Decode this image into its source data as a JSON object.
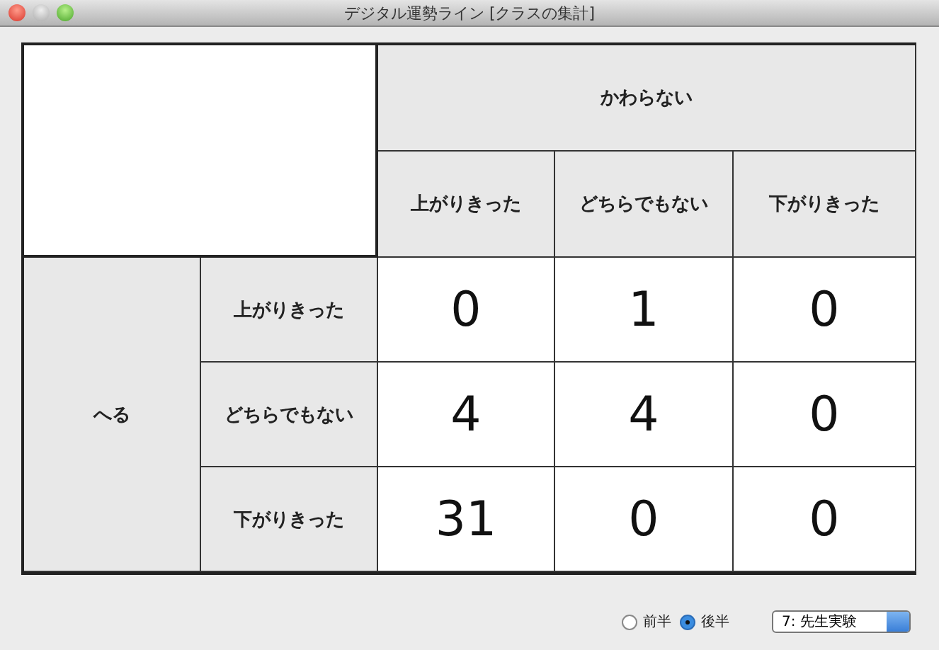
{
  "window": {
    "title": "デジタル運勢ライン [クラスの集計]"
  },
  "table": {
    "column_group": "かわらない",
    "columns": [
      "上がりきった",
      "どちらでもない",
      "下がりきった"
    ],
    "row_group": "へる",
    "rows": [
      {
        "label": "上がりきった",
        "cells": [
          "0",
          "1",
          "0"
        ]
      },
      {
        "label": "どちらでもない",
        "cells": [
          "4",
          "4",
          "0"
        ]
      },
      {
        "label": "下がりきった",
        "cells": [
          "31",
          "0",
          "0"
        ]
      }
    ]
  },
  "halves": [
    {
      "label": "前半",
      "selected": false
    },
    {
      "label": "後半",
      "selected": true
    }
  ],
  "class_select": {
    "value": "7: 先生実験"
  }
}
